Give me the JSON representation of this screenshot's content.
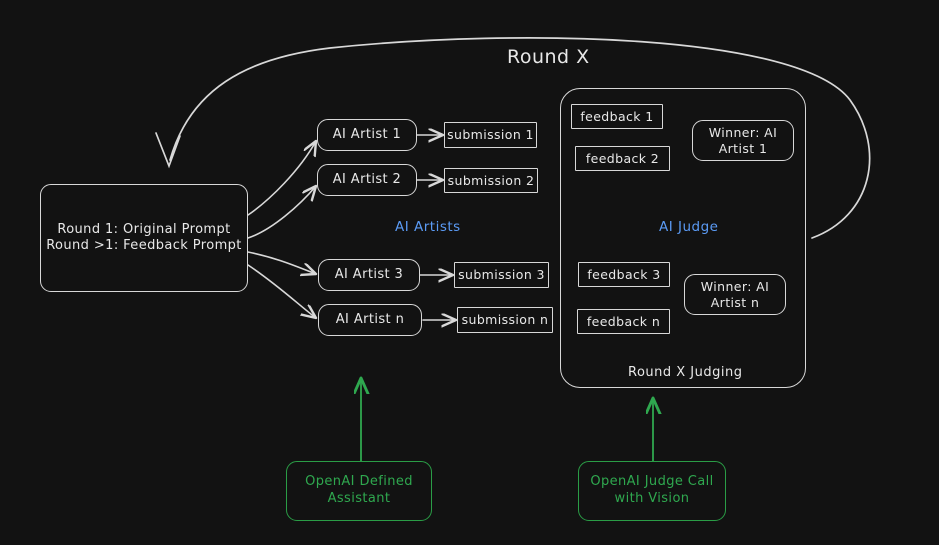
{
  "diagram": {
    "title": "Round X",
    "background_color": "#121212",
    "stroke_color": "#d8d8d8",
    "accent_blue": "#5b9bf5",
    "accent_green": "#2a9d46",
    "prompt_box": {
      "line1": "Round 1: Original Prompt",
      "line2": "Round >1: Feedback Prompt"
    },
    "artists_group_label": "AI Artists",
    "judge_group_label": "AI Judge",
    "judge_panel_caption": "Round X Judging",
    "artists": [
      {
        "name": "AI Artist 1",
        "submission": "submission 1"
      },
      {
        "name": "AI Artist 2",
        "submission": "submission 2"
      },
      {
        "name": "AI Artist 3",
        "submission": "submission 3"
      },
      {
        "name": "AI Artist n",
        "submission": "submission n"
      }
    ],
    "feedback_items": [
      "feedback 1",
      "feedback 2",
      "feedback 3",
      "feedback n"
    ],
    "winners": [
      "Winner: AI\nArtist 1",
      "Winner: AI\nArtist n"
    ],
    "green_nodes": [
      "OpenAI Defined\nAssistant",
      "OpenAI Judge Call\nwith Vision"
    ]
  }
}
